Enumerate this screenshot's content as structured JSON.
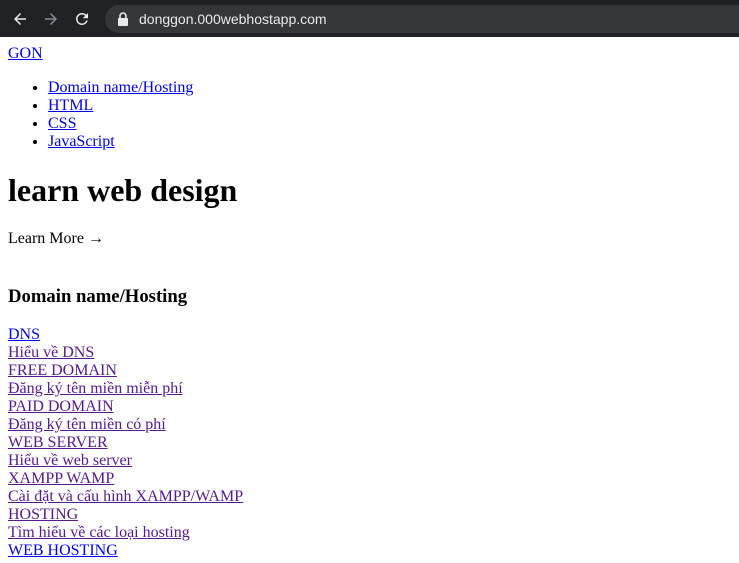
{
  "browser": {
    "url": "donggon.000webhostapp.com"
  },
  "site": {
    "logo": "GON",
    "nav": [
      "Domain name/Hosting",
      "HTML",
      "CSS",
      "JavaScript"
    ],
    "hero_title": "learn web design",
    "learn_more": "Learn More →",
    "section_title": "Domain name/Hosting",
    "links": [
      "DNS",
      "Hiểu về DNS",
      "FREE DOMAIN",
      "Đăng ký tên miền miễn phí",
      "PAID DOMAIN",
      "Đăng ký tên miền có phí",
      "WEB SERVER",
      "Hiểu về web server",
      "XAMPP WAMP",
      "Cài đặt và cấu hình XAMPP/WAMP",
      "HOSTING",
      "Tìm hiểu về các loại hosting",
      "WEB HOSTING"
    ]
  }
}
